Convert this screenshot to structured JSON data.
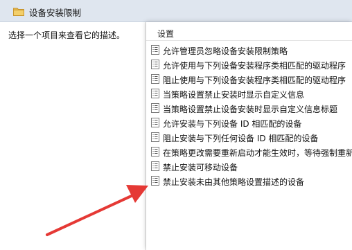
{
  "header": {
    "title": "设备安装限制",
    "folder_icon": "folder-icon"
  },
  "description_pane": {
    "text": "选择一个项目来查看它的描述。"
  },
  "list": {
    "column_header": "设置",
    "items": [
      {
        "label": "允许管理员忽略设备安装限制策略",
        "icon": "policy-setting-icon"
      },
      {
        "label": "允许使用与下列设备安装程序类相匹配的驱动程序",
        "icon": "policy-setting-icon"
      },
      {
        "label": "阻止使用与下列设备安装程序类相匹配的驱动程序",
        "icon": "policy-setting-icon"
      },
      {
        "label": "当策略设置禁止安装时显示自定义信息",
        "icon": "policy-setting-icon"
      },
      {
        "label": "当策略设置禁止设备安装时显示自定义信息标题",
        "icon": "policy-setting-icon"
      },
      {
        "label": "允许安装与下列设备 ID 相匹配的设备",
        "icon": "policy-setting-icon"
      },
      {
        "label": "阻止安装与下列任何设备 ID 相匹配的设备",
        "icon": "policy-setting-icon"
      },
      {
        "label": "在策略更改需要重新启动才能生效时，等待强制重新启动",
        "icon": "policy-setting-icon"
      },
      {
        "label": "禁止安装可移动设备",
        "icon": "policy-setting-icon"
      },
      {
        "label": "禁止安装未由其他策略设置描述的设备",
        "icon": "policy-setting-icon"
      }
    ]
  },
  "annotation": {
    "icon": "red-arrow-icon",
    "color": "#e53935"
  },
  "colors": {
    "topbar": "#dfe6ef",
    "folder": "#e8b84a",
    "pane": "#ffffff"
  }
}
